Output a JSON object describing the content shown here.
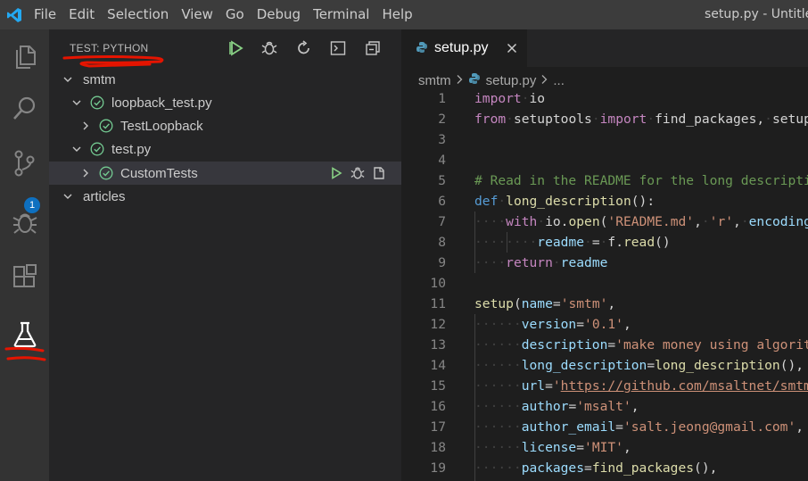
{
  "menu": [
    "File",
    "Edit",
    "Selection",
    "View",
    "Go",
    "Debug",
    "Terminal",
    "Help"
  ],
  "window_title": "setup.py - Untitled",
  "activity": {
    "scm_badge": "1"
  },
  "sidebar": {
    "title": "TEST: PYTHON",
    "tree": [
      {
        "label": "smtm",
        "status": "folder"
      },
      {
        "label": "loopback_test.py",
        "status": "passed"
      },
      {
        "label": "TestLoopback",
        "status": "passed"
      },
      {
        "label": "test.py",
        "status": "passed"
      },
      {
        "label": "CustomTests",
        "status": "passed"
      },
      {
        "label": "articles",
        "status": "folder"
      }
    ]
  },
  "editor": {
    "tab_label": "setup.py",
    "breadcrumb": [
      "smtm",
      "setup.py",
      "..."
    ],
    "line_numbers": [
      "1",
      "2",
      "3",
      "4",
      "5",
      "6",
      "7",
      "8",
      "9",
      "10",
      "11",
      "12",
      "13",
      "14",
      "15",
      "16",
      "17",
      "18",
      "19"
    ]
  },
  "colors": {
    "accent": "#0e70c0",
    "pass": "#73c991",
    "annotation": "#e51400"
  }
}
